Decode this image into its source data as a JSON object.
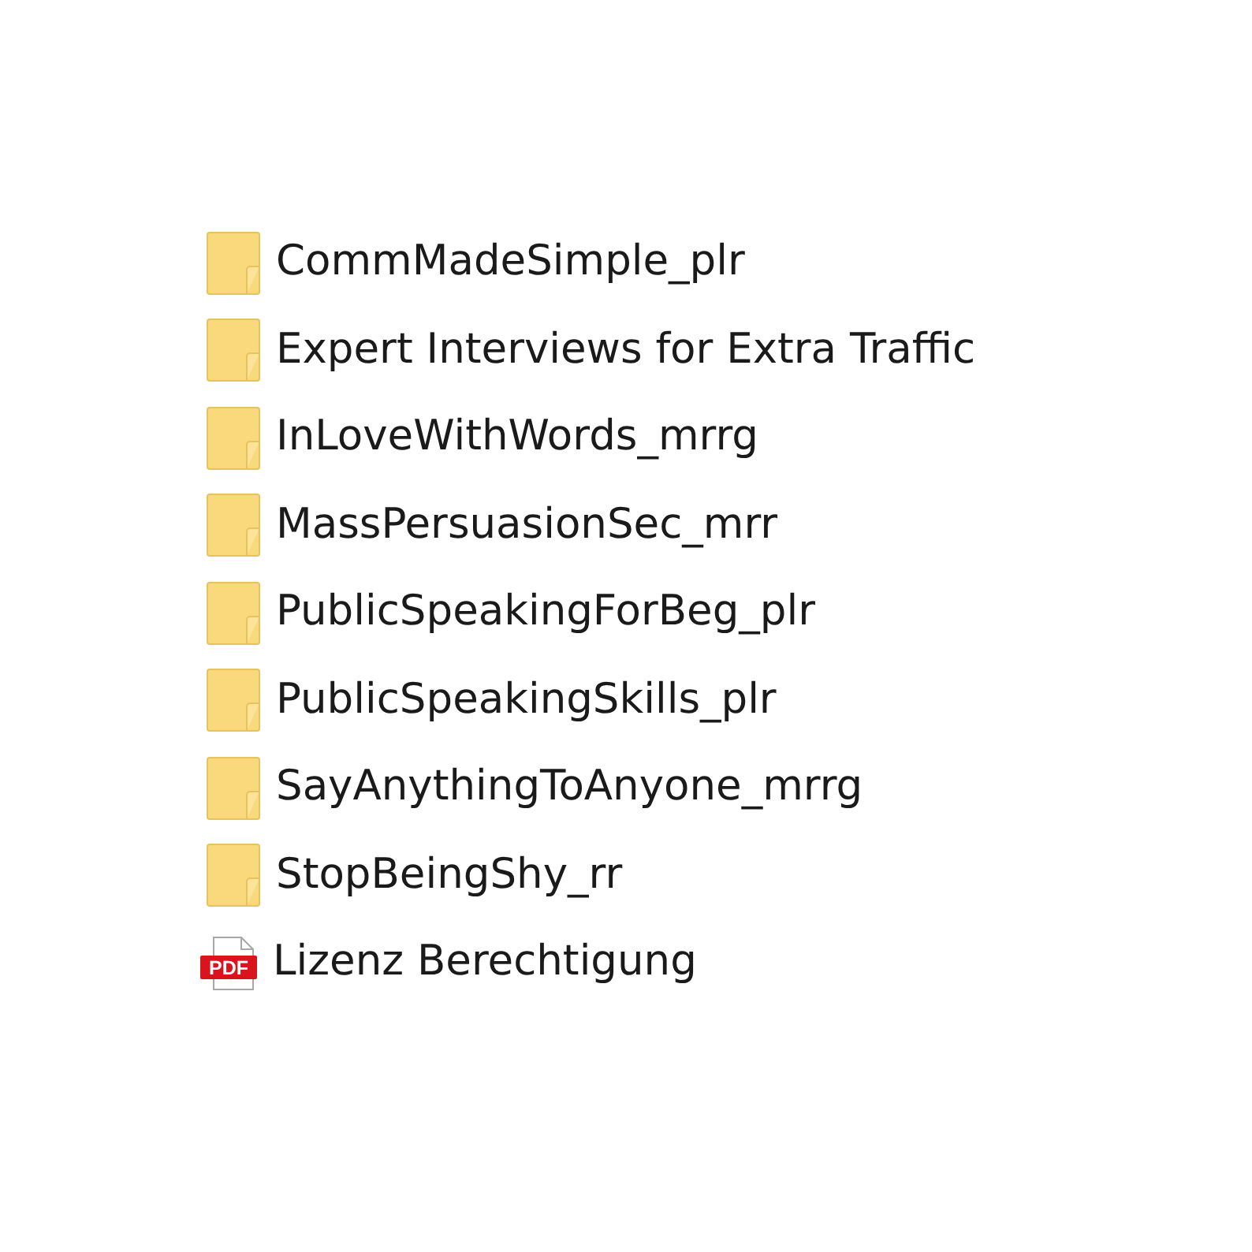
{
  "files": [
    {
      "kind": "folder",
      "name": "CommMadeSimple_plr"
    },
    {
      "kind": "folder",
      "name": "Expert Interviews for Extra Traffic"
    },
    {
      "kind": "folder",
      "name": "InLoveWithWords_mrrg"
    },
    {
      "kind": "folder",
      "name": "MassPersuasionSec_mrr"
    },
    {
      "kind": "folder",
      "name": "PublicSpeakingForBeg_plr"
    },
    {
      "kind": "folder",
      "name": "PublicSpeakingSkills_plr"
    },
    {
      "kind": "folder",
      "name": "SayAnythingToAnyone_mrrg"
    },
    {
      "kind": "folder",
      "name": "StopBeingShy_rr"
    },
    {
      "kind": "pdf",
      "name": "Lizenz Berechtigung",
      "icon_label": "PDF"
    }
  ]
}
